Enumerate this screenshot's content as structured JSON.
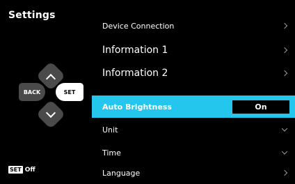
{
  "header": {
    "title": "Settings"
  },
  "controls": {
    "back_label": "BACK",
    "set_label": "SET",
    "up_icon": "chevron-up",
    "down_icon": "chevron-down"
  },
  "footer": {
    "badge": "SET",
    "text": "Off"
  },
  "menu": {
    "items": [
      {
        "label": "Device Connection",
        "indicator": "chevron-right"
      },
      {
        "label": "Information 1",
        "indicator": "chevron-right"
      },
      {
        "label": "Information 2",
        "indicator": "chevron-right"
      },
      {
        "label": "Auto Brightness",
        "value": "On",
        "selected": true
      },
      {
        "label": "Unit",
        "indicator": "chevron-down"
      },
      {
        "label": "Time",
        "indicator": "chevron-down"
      },
      {
        "label": "Language",
        "indicator": "chevron-right"
      }
    ]
  },
  "colors": {
    "highlight": "#24c6ee",
    "background": "#000000",
    "button": "#4a4a4a"
  }
}
